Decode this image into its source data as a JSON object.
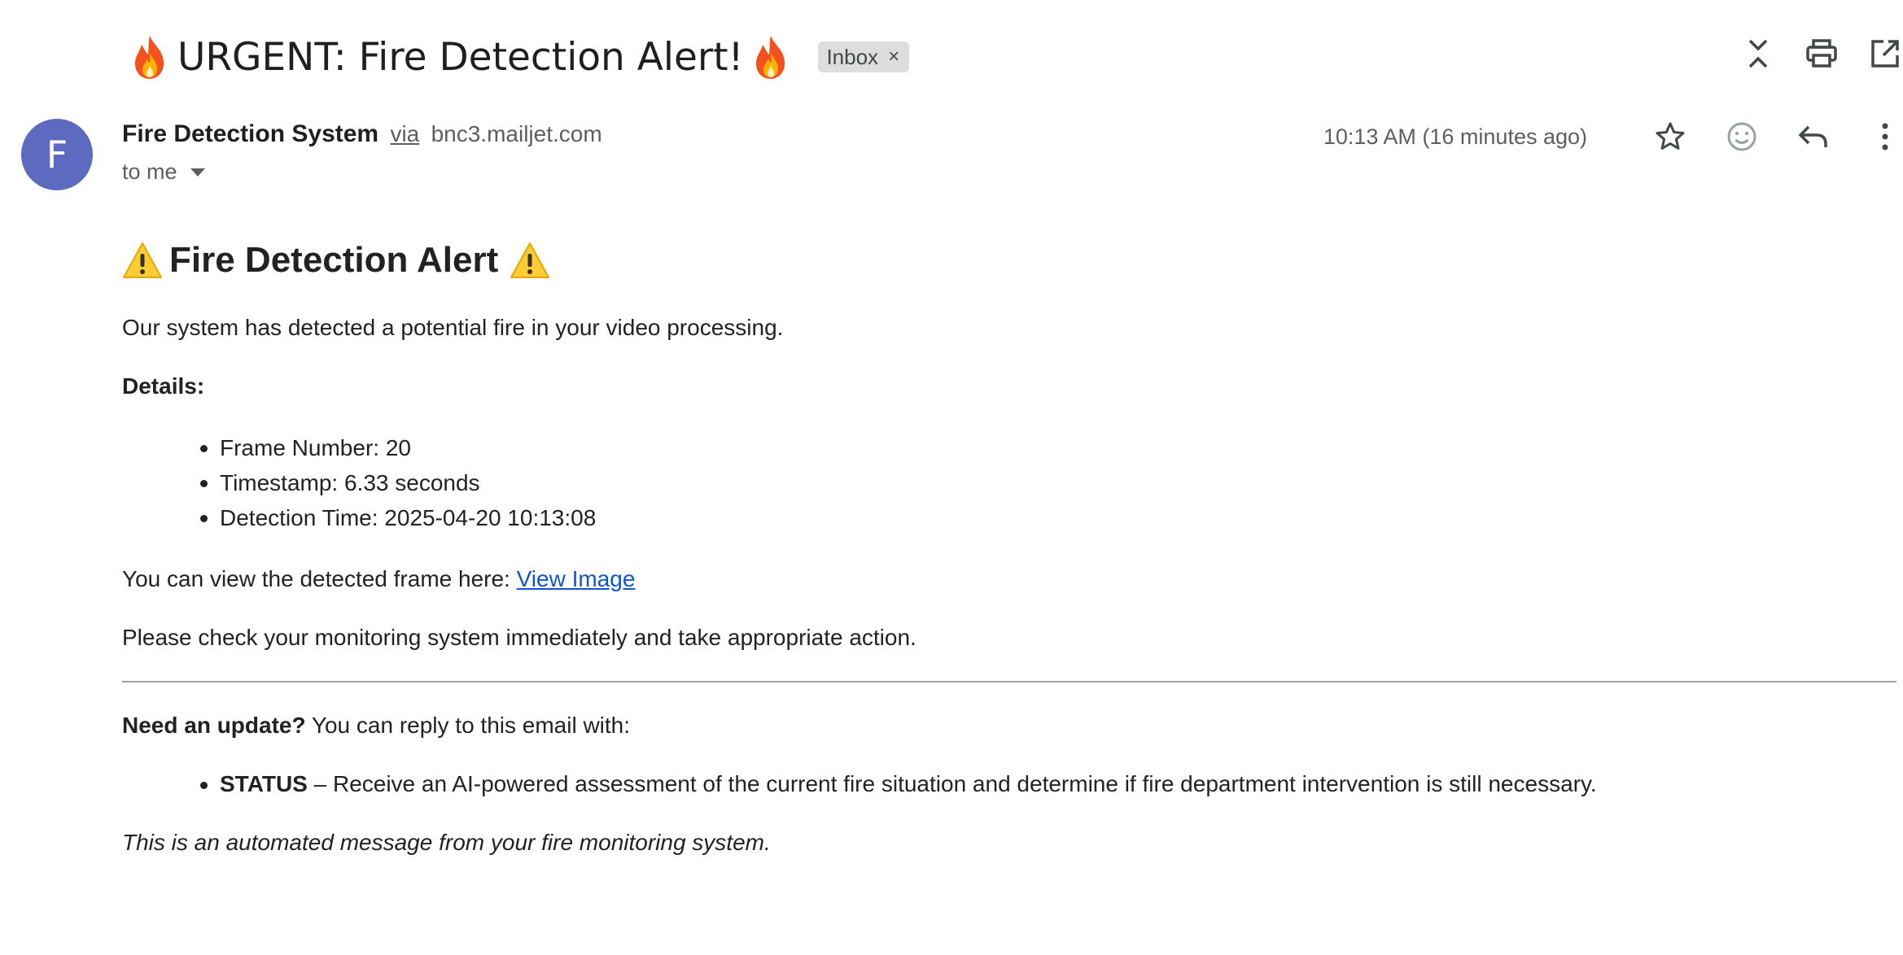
{
  "email": {
    "subject": "URGENT: Fire Detection Alert!",
    "label_chip": "Inbox",
    "label_chip_close": "×",
    "sender": {
      "avatar_letter": "F",
      "avatar_color": "#5c6bc0",
      "name": "Fire Detection System",
      "via": "via",
      "domain": "bnc3.mailjet.com",
      "recipient": "to me"
    },
    "timestamp": "10:13 AM (16 minutes ago)",
    "toolbar_icons": [
      "collapse-all-icon",
      "print-icon",
      "open-in-new-window-icon"
    ],
    "message_icons": [
      "star-icon",
      "emoji-reaction-icon",
      "reply-icon",
      "more-options-icon"
    ]
  },
  "body": {
    "heading": "Fire Detection Alert",
    "intro": "Our system has detected a potential fire in your video processing.",
    "details_label": "Details:",
    "details": [
      "Frame Number: 20",
      "Timestamp: 6.33 seconds",
      "Detection Time: 2025-04-20 10:13:08"
    ],
    "view_prefix": "You can view the detected frame here: ",
    "view_link": "View Image",
    "check_text": "Please check your monitoring system immediately and take appropriate action.",
    "update_bold": "Need an update?",
    "update_text": " You can reply to this email with:",
    "status_keyword": "STATUS",
    "status_text": " – Receive an AI-powered assessment of the current fire situation and determine if fire department intervention is still necessary.",
    "footer": "This is an automated message from your fire monitoring system."
  },
  "colors": {
    "link": "#1155cc",
    "chip_bg": "#dddddd",
    "avatar": "#5c6bc0"
  }
}
